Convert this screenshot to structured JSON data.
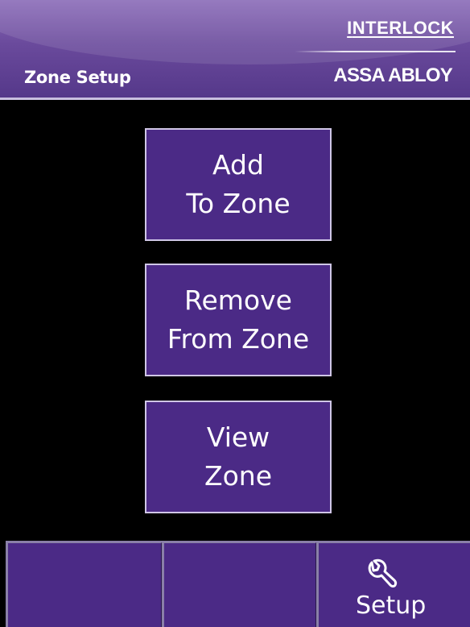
{
  "header": {
    "title": "Zone Setup",
    "brand_top_initial": "I",
    "brand_top_rest": "NTERLOCK",
    "brand_bottom": "ASSA ABLOY"
  },
  "menu": {
    "add": [
      "Add",
      "To Zone"
    ],
    "remove": [
      "Remove",
      "From Zone"
    ],
    "view": [
      "View",
      "Zone"
    ]
  },
  "footer_tabs": [
    {
      "label": ""
    },
    {
      "label": ""
    },
    {
      "label": "Setup",
      "icon": "wrench-icon"
    }
  ],
  "colors": {
    "background": "#000000",
    "header": "#6a4a9c",
    "button": "#4b2a86",
    "button_border": "#cfc6e6",
    "text": "#ffffff"
  }
}
